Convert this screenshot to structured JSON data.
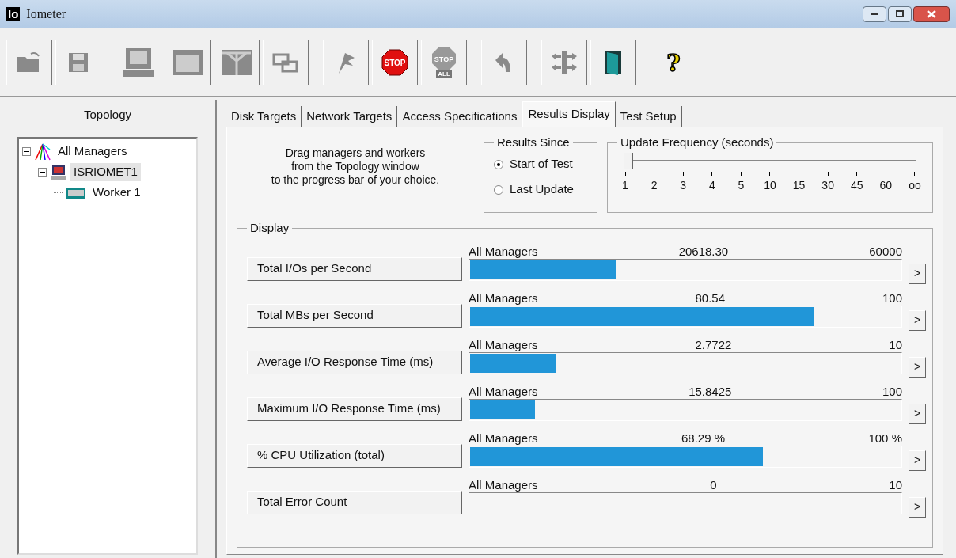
{
  "window": {
    "icon_text": "Io",
    "title": "Iometer"
  },
  "toolbar": [
    {
      "kind": "open"
    },
    {
      "kind": "save"
    },
    {
      "kind": "gap"
    },
    {
      "kind": "manager"
    },
    {
      "kind": "disk"
    },
    {
      "kind": "network"
    },
    {
      "kind": "copy"
    },
    {
      "kind": "gap"
    },
    {
      "kind": "flag"
    },
    {
      "kind": "stop",
      "label": "STOP"
    },
    {
      "kind": "stopall",
      "label": "STOP",
      "sublabel": "ALL"
    },
    {
      "kind": "gap"
    },
    {
      "kind": "reset"
    },
    {
      "kind": "gap"
    },
    {
      "kind": "workers"
    },
    {
      "kind": "exit"
    },
    {
      "kind": "gap"
    },
    {
      "kind": "help",
      "label": "?"
    }
  ],
  "topology": {
    "title": "Topology",
    "tree": [
      {
        "label": "All Managers",
        "kind": "all",
        "expanded": true,
        "selected": false,
        "children": [
          {
            "label": "ISRIOMET1",
            "kind": "manager",
            "expanded": true,
            "selected": true,
            "children": [
              {
                "label": "Worker 1",
                "kind": "worker",
                "selected": false
              }
            ]
          }
        ]
      }
    ]
  },
  "tabs": [
    {
      "label": "Disk Targets",
      "selected": false
    },
    {
      "label": "Network Targets",
      "selected": false
    },
    {
      "label": "Access Specifications",
      "selected": false
    },
    {
      "label": "Results Display",
      "selected": true
    },
    {
      "label": "Test Setup",
      "selected": false
    }
  ],
  "hint": "Drag managers and workers\nfrom the Topology window\nto the progress bar of your choice.",
  "results_since": {
    "title": "Results Since",
    "options": [
      {
        "label": "Start of Test",
        "selected": true
      },
      {
        "label": "Last Update",
        "selected": false
      }
    ]
  },
  "update_frequency": {
    "title": "Update Frequency (seconds)",
    "level": 0,
    "ticks": [
      "1",
      "2",
      "3",
      "4",
      "5",
      "10",
      "15",
      "30",
      "45",
      "60",
      "oo"
    ]
  },
  "display": {
    "title": "Display",
    "rows": [
      {
        "label": "Total I/Os per Second",
        "scope": "All Managers",
        "value": "20618.30",
        "max": "60000",
        "level": 0.34,
        "more": ">"
      },
      {
        "label": "Total MBs per Second",
        "scope": "All Managers",
        "value": "80.54",
        "max": "100",
        "level": 0.8,
        "more": ">"
      },
      {
        "label": "Average I/O Response Time (ms)",
        "scope": "All Managers",
        "value": "2.7722",
        "max": "10",
        "level": 0.2,
        "more": ">"
      },
      {
        "label": "Maximum I/O Response Time (ms)",
        "scope": "All Managers",
        "value": "15.8425",
        "max": "100",
        "level": 0.15,
        "more": ">"
      },
      {
        "label": "% CPU Utilization (total)",
        "scope": "All Managers",
        "value": "68.29 %",
        "max": "100 %",
        "level": 0.68,
        "more": ">"
      },
      {
        "label": "Total Error Count",
        "scope": "All Managers",
        "value": "0",
        "max": "10",
        "more": ">"
      }
    ]
  }
}
